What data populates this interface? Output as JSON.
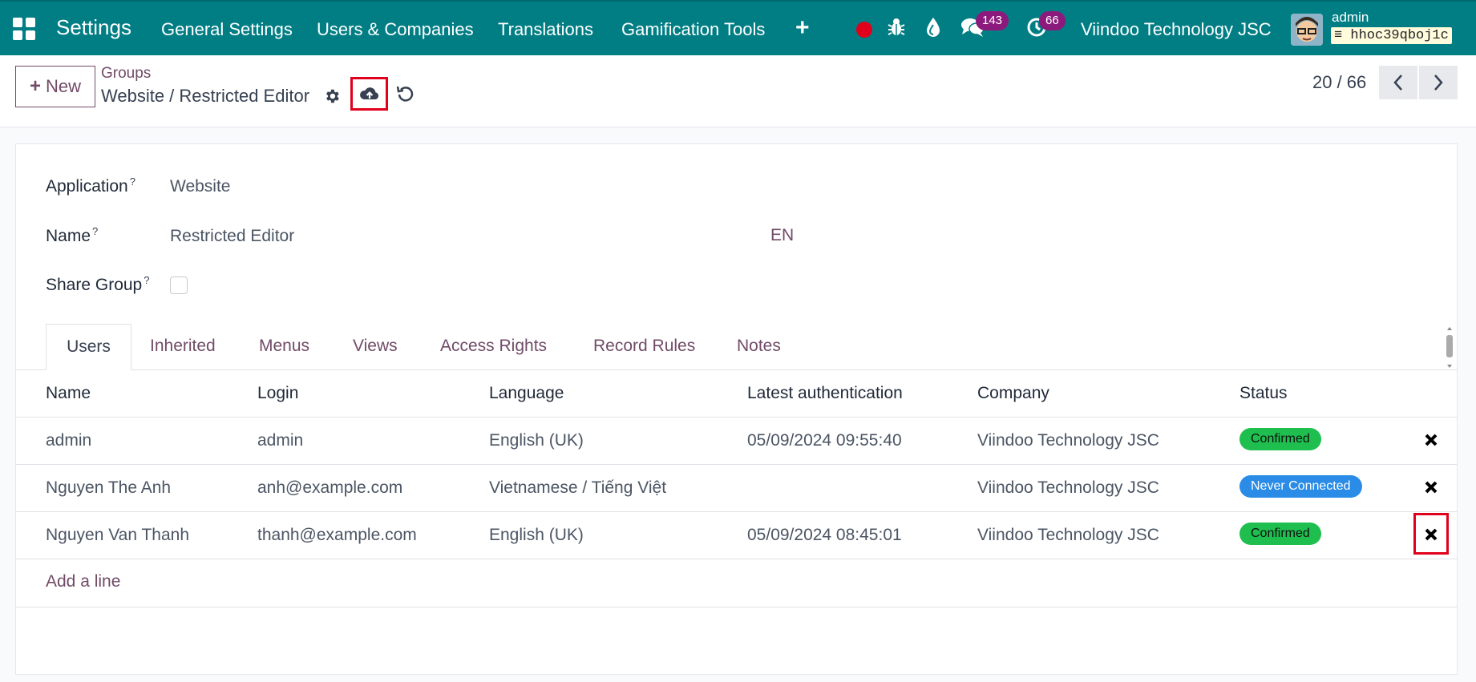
{
  "navbar": {
    "app_title": "Settings",
    "menu": [
      "General Settings",
      "Users & Companies",
      "Translations",
      "Gamification Tools"
    ],
    "messages_count": "143",
    "activities_count": "66",
    "company": "Viindoo Technology JSC",
    "user": "admin",
    "database": "hhoc39qboj1c",
    "accent_color": "#017e84"
  },
  "control": {
    "new_label": "New",
    "breadcrumb_parent": "Groups",
    "breadcrumb_current": "Website / Restricted Editor",
    "pager": "20 / 66"
  },
  "form": {
    "application_label": "Application",
    "application_value": "Website",
    "name_label": "Name",
    "name_value": "Restricted Editor",
    "lang_button": "EN",
    "share_label": "Share Group",
    "share_checked": false,
    "help_mark": "?"
  },
  "tabs": [
    "Users",
    "Inherited",
    "Menus",
    "Views",
    "Access Rights",
    "Record Rules",
    "Notes"
  ],
  "table": {
    "columns": [
      "Name",
      "Login",
      "Language",
      "Latest authentication",
      "Company",
      "Status"
    ],
    "rows": [
      {
        "name": "admin",
        "login": "admin",
        "language": "English (UK)",
        "latest_auth": "05/09/2024 09:55:40",
        "company": "Viindoo Technology JSC",
        "status": "Confirmed",
        "status_color": "#1fbf4f"
      },
      {
        "name": "Nguyen The Anh",
        "login": "anh@example.com",
        "language": "Vietnamese / Tiếng Việt",
        "latest_auth": "",
        "company": "Viindoo Technology JSC",
        "status": "Never Connected",
        "status_color": "#2a8ce6"
      },
      {
        "name": "Nguyen Van Thanh",
        "login": "thanh@example.com",
        "language": "English (UK)",
        "latest_auth": "05/09/2024 08:45:01",
        "company": "Viindoo Technology JSC",
        "status": "Confirmed",
        "status_color": "#1fbf4f"
      }
    ],
    "add_line": "Add a line"
  }
}
